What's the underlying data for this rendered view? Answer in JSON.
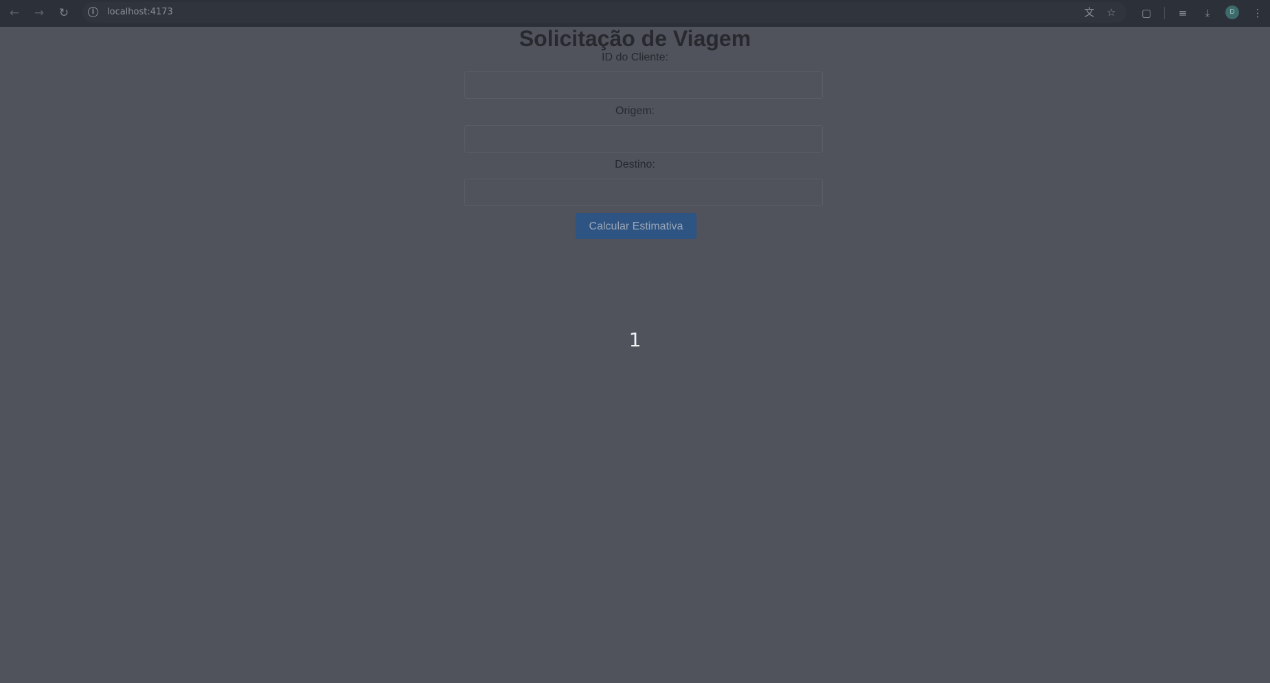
{
  "browser": {
    "url": "localhost:4173",
    "back_icon": "arrow-left-icon",
    "forward_icon": "arrow-right-icon",
    "reload_icon": "reload-icon",
    "site_info_icon": "info-icon",
    "translate_icon": "translate-icon",
    "bookmark_icon": "star-icon",
    "extensions_icon": "puzzle-icon",
    "media_icon": "playlist-icon",
    "download_icon": "download-icon",
    "profile_initial": "D",
    "menu_icon": "kebab-menu-icon"
  },
  "page": {
    "title": "Solicitação de Viagem",
    "form": {
      "customer_id_label": "ID do Cliente:",
      "customer_id_value": "",
      "origin_label": "Origem:",
      "origin_value": "",
      "destination_label": "Destino:",
      "destination_value": "",
      "submit_label": "Calcular Estimativa"
    },
    "result": "1"
  },
  "colors": {
    "page_background": "#50535c",
    "toolbar_background": "#2c3038",
    "button_background": "#2e5483",
    "title_text": "#27292e",
    "result_text": "#f1f2f4"
  }
}
